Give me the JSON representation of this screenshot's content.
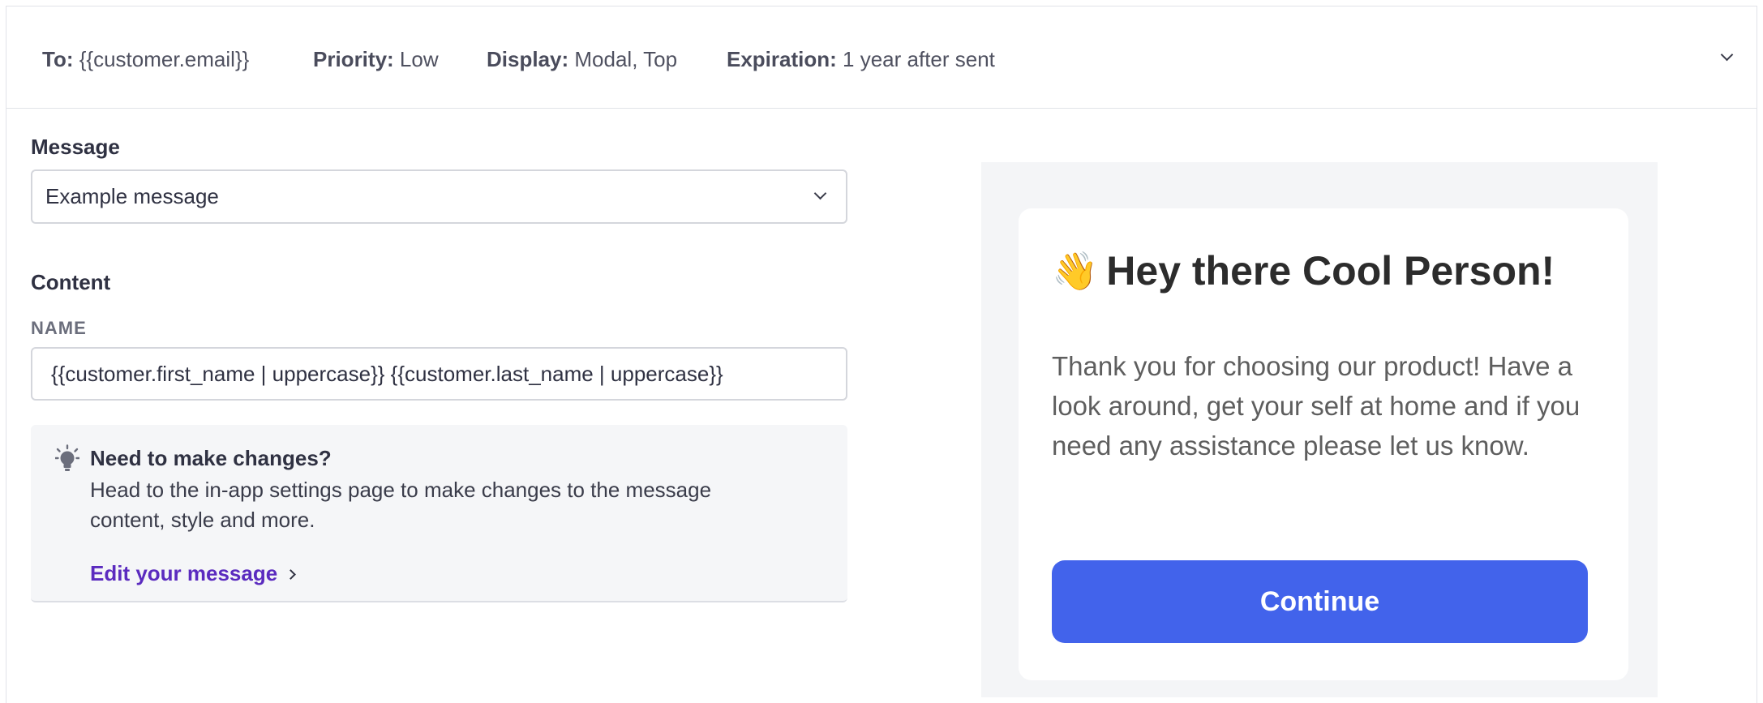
{
  "summary": {
    "to_label": "To:",
    "to_value": "{{customer.email}}",
    "priority_label": "Priority:",
    "priority_value": "Low",
    "display_label": "Display:",
    "display_value": "Modal, Top",
    "expiration_label": "Expiration:",
    "expiration_value": "1 year after sent"
  },
  "form": {
    "message_label": "Message",
    "message_selected": "Example message",
    "content_label": "Content",
    "name_label": "NAME",
    "name_value": "{{customer.first_name | uppercase}} {{customer.last_name | uppercase}}"
  },
  "notice": {
    "icon": "lightbulb-icon",
    "title": "Need to make changes?",
    "body": "Head to the in-app settings page to make changes to the message content, style and more.",
    "link_label": "Edit your message"
  },
  "preview": {
    "emoji": "👋",
    "title": "Hey there Cool Person!",
    "body": "Thank you for choosing our product! Have a look around, get your self at home and if you need any assistance please let us know.",
    "button_label": "Continue",
    "button_color": "#4263eb"
  },
  "colors": {
    "link": "#5b2bbf",
    "preview_background": "#f4f5f7"
  }
}
